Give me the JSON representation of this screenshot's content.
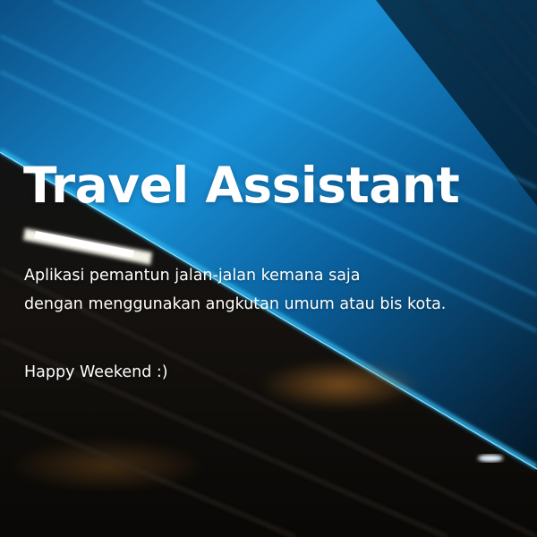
{
  "hero": {
    "title": "Travel Assistant",
    "description_lines": [
      "Aplikasi pemantun jalan-jalan kemana saja",
      "dengan menggunakan angkutan umum atau bis kota."
    ],
    "greeting": "Happy Weekend :)"
  },
  "colors": {
    "accent_light": "#2fb6f0",
    "tunnel_blue": "#0a6fb5",
    "tunnel_dark": "#07121c",
    "text": "#ffffff"
  }
}
